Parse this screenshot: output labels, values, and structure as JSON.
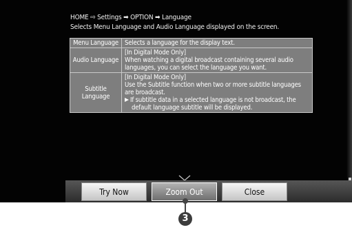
{
  "header": {
    "breadcrumb": "HOME ⇨ Settings ➡ OPTION ➡ Language",
    "subtitle": "Selects Menu Language and Audio Language displayed on the screen."
  },
  "table": {
    "rows": [
      {
        "label_lines": [
          "Menu Language"
        ],
        "desc_lines": [
          "Selects a language for the display text."
        ],
        "note_lines": []
      },
      {
        "label_lines": [
          "Audio Language"
        ],
        "desc_lines": [
          "[In Digital Mode Only]",
          "When watching a digital broadcast containing several audio",
          "languages, you can select the language you want."
        ],
        "note_lines": []
      },
      {
        "label_lines": [
          "Subtitle",
          "Language"
        ],
        "desc_lines": [
          "[In Digital Mode Only]",
          "Use the Subtitle function when two or more subtitle languages",
          "are broadcast."
        ],
        "note_lines": [
          "If subtitle data in a selected language is not broadcast, the",
          "default language subtitle will be displayed."
        ]
      }
    ]
  },
  "buttons": {
    "try_now": "Try Now",
    "zoom_out": "Zoom Out",
    "close": "Close"
  },
  "callout": {
    "number": "3"
  },
  "icons": {
    "note": "note-icon",
    "scroll": "chevron-down-icon"
  },
  "colors": {
    "screen_bg": "#030303",
    "table_cell_bg": "#7e7e7e",
    "focused_button": "#8c8c8c",
    "button": "#d8d8d8"
  }
}
